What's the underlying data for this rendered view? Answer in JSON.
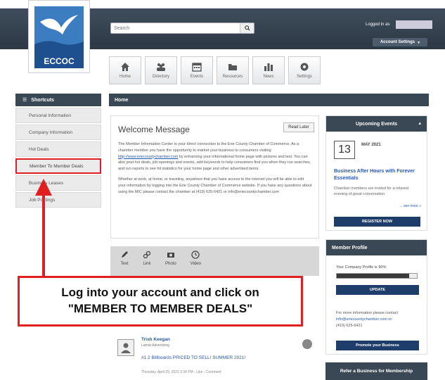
{
  "header": {
    "search_placeholder": "Search",
    "logged_in_label": "Logged in as",
    "account_settings": "Account Settings"
  },
  "logo": {
    "text": "ECCOC"
  },
  "nav": [
    {
      "label": "Home",
      "icon": "home-icon"
    },
    {
      "label": "Directory",
      "icon": "directory-icon"
    },
    {
      "label": "Events",
      "icon": "events-icon"
    },
    {
      "label": "Resources",
      "icon": "folder-icon"
    },
    {
      "label": "News",
      "icon": "news-icon"
    },
    {
      "label": "Settings",
      "icon": "settings-icon"
    }
  ],
  "breadcrumb": "Home",
  "shortcuts": {
    "title": "Shortcuts",
    "items": [
      "Personal Information",
      "Company Information",
      "Hot Deals",
      "Member To Member Deals",
      "Business Leases",
      "Job Postings"
    ]
  },
  "welcome": {
    "title": "Welcome Message",
    "read_later": "Read Later",
    "para1_a": "The Member Information Center is your direct connection to the Erie County Chamber of Commerce. As a chamber member you have the opportunity to market your business to consumers visiting",
    "para1_link": "http://www.eriecountychamber.com",
    "para1_b": "by enhancing your informational home page with pictures and text. You can also post hot deals, job openings and events, add keywords to help consumers find you when they run searches, and run reports to see hit statistics for your home page and other advertised items.",
    "para2": "Whether at work, at home, or traveling, anywhere that you have access to the internet you will be able to edit your information by logging into the Erie County Chamber of Commerce website. If you have any questions about using the MIC please contact the chamber at (419) 625-6421 or info@eriecountychamber.com"
  },
  "post_tools": [
    {
      "label": "Text",
      "icon": "pencil-icon"
    },
    {
      "label": "Link",
      "icon": "link-icon"
    },
    {
      "label": "Photo",
      "icon": "camera-icon"
    },
    {
      "label": "Video",
      "icon": "video-icon"
    }
  ],
  "callout": {
    "line1": "Log into your account and click on",
    "line2": "\"MEMBER TO MEMBER DEALS\""
  },
  "post": {
    "author": "Trish Keegan",
    "subtitle": "Lamar Advertising",
    "text": "#1 2 Billboards PRICED TO SELL! SUMMER 2021!",
    "meta": "Thursday, April 29, 2021 3:34 PM - Like - Comment"
  },
  "events": {
    "title": "Upcoming Events",
    "day": "13",
    "month_year": "MAY 2021",
    "event_title": "Business After Hours with Forever Essentials",
    "event_desc": "Chamber members are invited for a relaxed evening of great conversation",
    "see_more": "... see more »",
    "register": "REGISTER NOW"
  },
  "profile": {
    "title": "Member Profile",
    "completion_text": "Your Company Profile is 90%",
    "completion": 0.9,
    "update": "UPDATE",
    "info_a": "For more information please contact",
    "info_email": "info@eriecountychamber.com or",
    "info_phone": "(419) 625-6421",
    "promote": "Promote your Business"
  },
  "refer": "Refer a Business for Membership",
  "colors": {
    "header": "#2c3844",
    "accent": "#1f3d6b",
    "highlight": "#e02020"
  }
}
